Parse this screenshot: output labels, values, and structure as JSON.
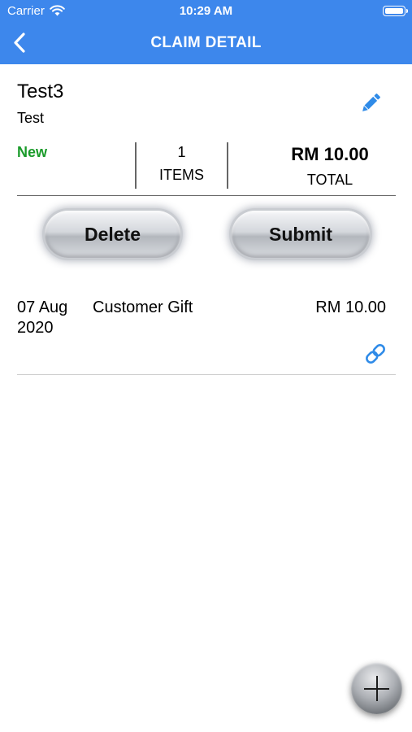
{
  "status_bar": {
    "carrier": "Carrier",
    "time": "10:29 AM"
  },
  "nav": {
    "title": "CLAIM DETAIL",
    "back_icon": "chevron-left-icon"
  },
  "claim": {
    "name": "Test3",
    "description": "Test",
    "status": "New",
    "item_count": "1",
    "items_label": "ITEMS",
    "total_amount": "RM 10.00",
    "total_label": "TOTAL",
    "edit_icon": "pencil-icon"
  },
  "actions": {
    "delete_label": "Delete",
    "submit_label": "Submit"
  },
  "line_items": [
    {
      "date": "07 Aug 2020",
      "category": "Customer Gift",
      "amount": "RM 10.00",
      "attachment_icon": "link-icon"
    }
  ],
  "fab": {
    "icon": "plus-icon"
  },
  "colors": {
    "header": "#3d87ec",
    "status_new": "#1a9b2a",
    "icon_blue": "#2f8be8"
  }
}
